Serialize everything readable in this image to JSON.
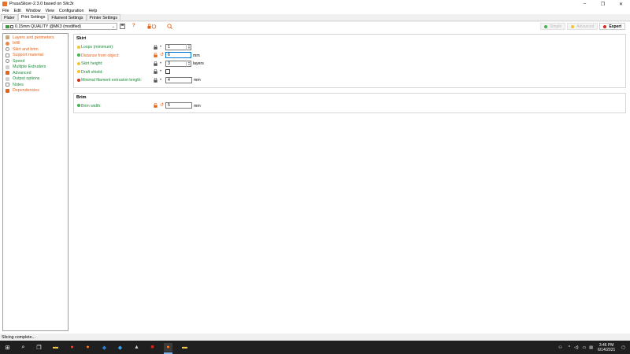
{
  "window": {
    "title": "PrusaSlicer-2.3.0 based on Slic3r",
    "controls": {
      "minimize": "–",
      "maximize": "❐",
      "close": "✕"
    }
  },
  "menu": [
    "File",
    "Edit",
    "Window",
    "View",
    "Configuration",
    "Help"
  ],
  "tabs": [
    {
      "label": "Plater",
      "active": false
    },
    {
      "label": "Print Settings",
      "active": true
    },
    {
      "label": "Filament Settings",
      "active": false
    },
    {
      "label": "Printer Settings",
      "active": false
    }
  ],
  "toolbar": {
    "preset": "0.15mm QUALITY @MK3 (modified)",
    "icons": [
      "save-icon",
      "question-icon",
      "lock-undo-icon",
      "search-icon"
    ],
    "modes": [
      {
        "label": "Simple",
        "color": "#3fb34f",
        "active": false
      },
      {
        "label": "Advanced",
        "color": "#f2c42e",
        "active": false
      },
      {
        "label": "Expert",
        "color": "#d7261e",
        "active": true
      }
    ]
  },
  "sidebar": {
    "items": [
      {
        "label": "Layers and perimeters",
        "color": "orange"
      },
      {
        "label": "Infill",
        "color": "orange"
      },
      {
        "label": "Skirt and brim",
        "color": "orange",
        "selected": true
      },
      {
        "label": "Support material",
        "color": "orange"
      },
      {
        "label": "Speed",
        "color": "green"
      },
      {
        "label": "Multiple Extruders",
        "color": "green"
      },
      {
        "label": "Advanced",
        "color": "green"
      },
      {
        "label": "Output options",
        "color": "green"
      },
      {
        "label": "Notes",
        "color": "green"
      },
      {
        "label": "Dependencies",
        "color": "orange"
      }
    ]
  },
  "groups": [
    {
      "title": "Skirt",
      "options": [
        {
          "label": "Loops (minimum):",
          "bullet": "#f2c42e",
          "label_color": "green",
          "modified": false,
          "type": "spin",
          "value": "1",
          "unit": ""
        },
        {
          "label": "Distance from object:",
          "bullet": "#3fb34f",
          "label_color": "orange",
          "modified": true,
          "type": "text",
          "value": "6",
          "unit": "mm",
          "focus": true
        },
        {
          "label": "Skirt height:",
          "bullet": "#f2c42e",
          "label_color": "green",
          "modified": false,
          "type": "spin",
          "value": "3",
          "unit": "layers"
        },
        {
          "label": "Draft shield:",
          "bullet": "#f2c42e",
          "label_color": "green",
          "modified": false,
          "type": "checkbox",
          "value": "",
          "unit": ""
        },
        {
          "label": "Minimal filament extrusion length:",
          "bullet": "#d7261e",
          "label_color": "green",
          "modified": false,
          "type": "text",
          "value": "4",
          "unit": "mm"
        }
      ]
    },
    {
      "title": "Brim",
      "options": [
        {
          "label": "Brim width:",
          "bullet": "#3fb34f",
          "label_color": "green",
          "modified": true,
          "type": "text",
          "value": "5",
          "unit": "mm"
        }
      ]
    }
  ],
  "status": "Slicing complete...",
  "taskbar": {
    "apps": [
      {
        "name": "start-icon",
        "glyph": "⊞"
      },
      {
        "name": "search-icon",
        "glyph": "⌕"
      },
      {
        "name": "task-view-icon",
        "glyph": "❐"
      },
      {
        "name": "file-explorer-icon",
        "glyph": "▬"
      },
      {
        "name": "chrome-icon",
        "glyph": "●"
      },
      {
        "name": "browser-icon",
        "glyph": "●"
      },
      {
        "name": "vscode-icon",
        "glyph": "◆"
      },
      {
        "name": "app-blue-icon",
        "glyph": "◆"
      },
      {
        "name": "app-dark-icon",
        "glyph": "▲"
      },
      {
        "name": "app-red-icon",
        "glyph": "■"
      },
      {
        "name": "prusaslicer-icon",
        "glyph": "●",
        "active": true
      },
      {
        "name": "folder-icon",
        "glyph": "▬"
      }
    ],
    "time": "3:46 PM",
    "date": "6/14/2021"
  }
}
